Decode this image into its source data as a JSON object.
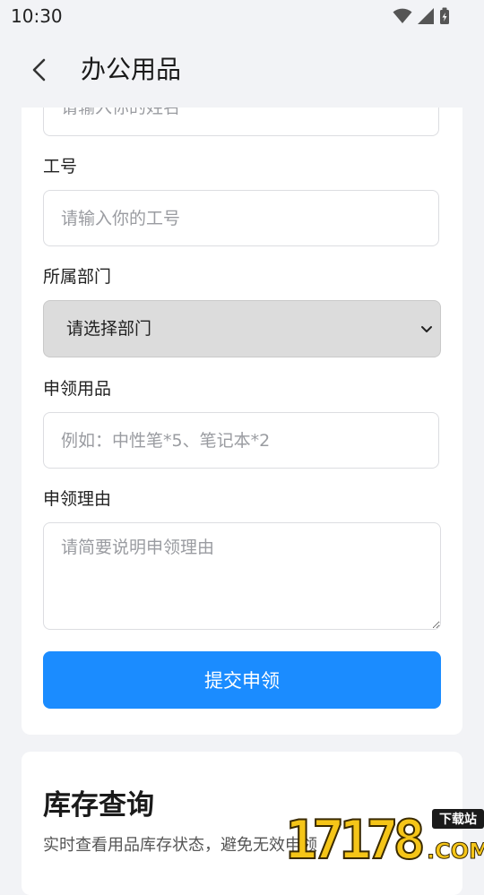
{
  "status_bar": {
    "time": "10:30",
    "icons": [
      "wifi-icon",
      "cellular-signal-icon",
      "battery-charging-icon"
    ]
  },
  "app_bar": {
    "title": "办公用品",
    "back_icon": "chevron-left-icon"
  },
  "form": {
    "name_placeholder": "请输入你的姓名",
    "employee_id_label": "工号",
    "employee_id_placeholder": "请输入你的工号",
    "department_label": "所属部门",
    "department_selected": "请选择部门",
    "items_label": "申领用品",
    "items_placeholder": "例如：中性笔*5、笔记本*2",
    "reason_label": "申领理由",
    "reason_placeholder": "请简要说明申领理由",
    "submit_label": "提交申领"
  },
  "inventory": {
    "title": "库存查询",
    "description": "实时查看用品库存状态，避免无效申领"
  },
  "watermark": {
    "brand": "17178",
    "tag": "下载站",
    "suffix": ".COM"
  },
  "colors": {
    "primary": "#1b8cff",
    "page_background": "#f2f3f6",
    "card_background": "#ffffff",
    "select_background": "#dcdcdc"
  }
}
